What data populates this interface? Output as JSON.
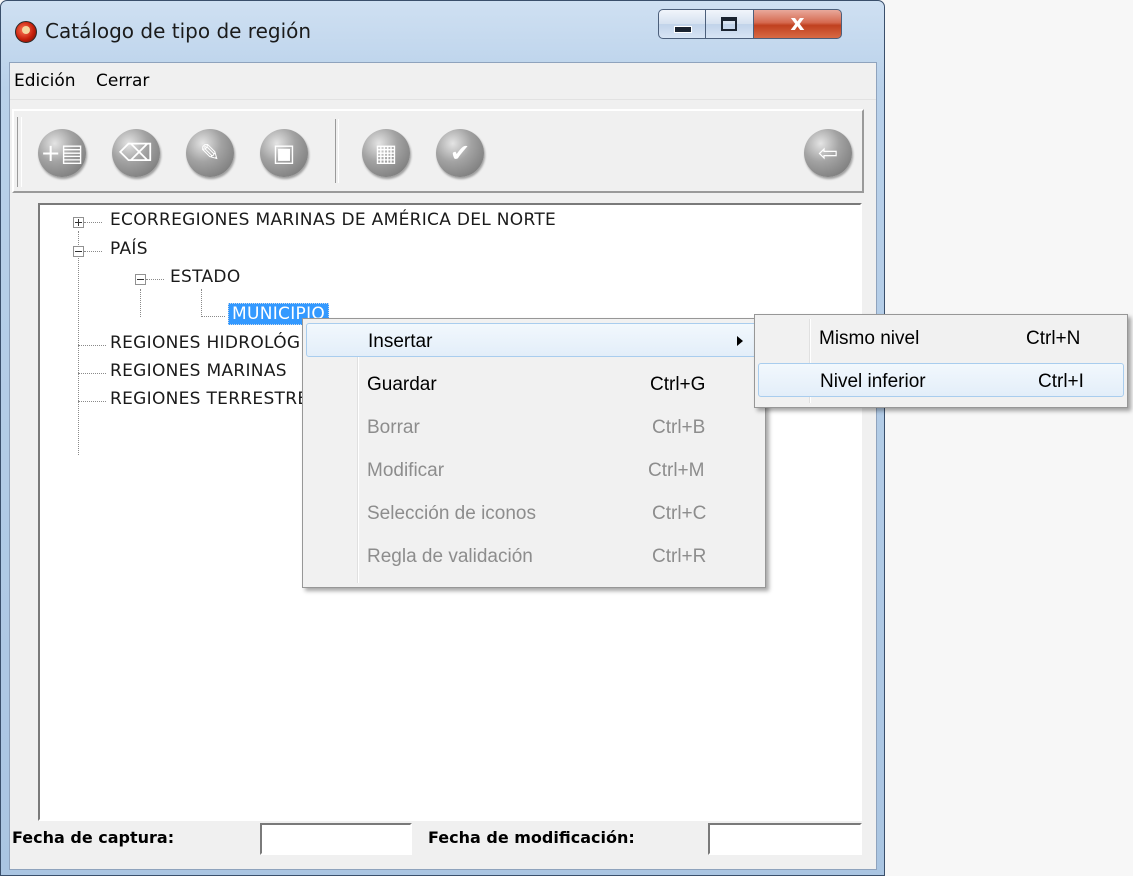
{
  "window": {
    "title": "Catálogo de tipo de región",
    "icon": "app-bug-icon"
  },
  "caption_buttons": {
    "close_glyph": "x"
  },
  "menubar": {
    "items": [
      "Edición",
      "Cerrar"
    ]
  },
  "toolbar": {
    "buttons": [
      {
        "name": "new-record-button",
        "glyph": "+▤"
      },
      {
        "name": "erase-button",
        "glyph": "⌫"
      },
      {
        "name": "edit-button",
        "glyph": "✎"
      },
      {
        "name": "save-button",
        "glyph": "▣"
      },
      {
        "name": "film-button",
        "glyph": "▦"
      },
      {
        "name": "validate-button",
        "glyph": "✔"
      },
      {
        "name": "exit-button",
        "glyph": "⇦"
      }
    ]
  },
  "tree": {
    "nodes": [
      "ECORREGIONES MARINAS DE AMÉRICA DEL NORTE",
      "PAÍS",
      "ESTADO",
      "MUNICIPIO",
      "REGIONES HIDROLÓGICAS",
      "REGIONES MARINAS",
      "REGIONES TERRESTRES"
    ]
  },
  "footer": {
    "capture_label": "Fecha de captura:",
    "capture_value": "",
    "modified_label": "Fecha de modificación:",
    "modified_value": ""
  },
  "context_menu": {
    "items": [
      {
        "label": "Insertar",
        "shortcut": "",
        "submenu": true,
        "enabled": true
      },
      {
        "label": "Guardar",
        "shortcut": "Ctrl+G",
        "enabled": true
      },
      {
        "label": "Borrar",
        "shortcut": "Ctrl+B",
        "enabled": false
      },
      {
        "label": "Modificar",
        "shortcut": "Ctrl+M",
        "enabled": false
      },
      {
        "label": "Selección de iconos",
        "shortcut": "Ctrl+C",
        "enabled": false
      },
      {
        "label": "Regla de validación",
        "shortcut": "Ctrl+R",
        "enabled": false
      }
    ]
  },
  "submenu": {
    "items": [
      {
        "label": "Mismo nivel",
        "shortcut": "Ctrl+N"
      },
      {
        "label": "Nivel inferior",
        "shortcut": "Ctrl+I"
      }
    ]
  }
}
